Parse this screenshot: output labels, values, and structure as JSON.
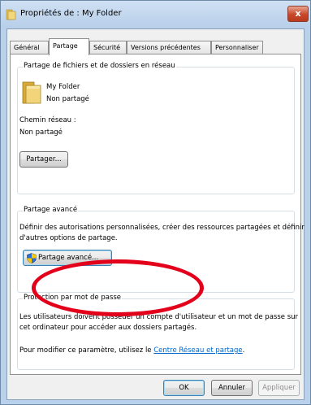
{
  "window": {
    "title": "Propriétés de : My Folder",
    "close_label": "x"
  },
  "tabs": [
    {
      "label": "Général"
    },
    {
      "label": "Partage"
    },
    {
      "label": "Sécurité"
    },
    {
      "label": "Versions précédentes"
    },
    {
      "label": "Personnaliser"
    }
  ],
  "sharing": {
    "group_title": "Partage de fichiers et de dossiers en réseau",
    "folder_name": "My Folder",
    "folder_status": "Non partagé",
    "network_path_label": "Chemin réseau :",
    "network_path_value": "Non partagé",
    "share_button": "Partager..."
  },
  "advanced": {
    "group_title": "Partage avancé",
    "description_line1": "Définir des autorisations personnalisées, créer des ressources partagées et définir",
    "description_line2": "d'autres options de partage.",
    "button": "Partage avancé..."
  },
  "protection": {
    "group_title": "Protection par mot de passe",
    "text_line1": "Les utilisateurs doivent posséder un compte d'utilisateur et un mot de passe sur",
    "text_line2": "cet ordinateur pour accéder aux dossiers partagés.",
    "text_line3": "Pour modifier ce paramètre, utilisez le",
    "link": "Centre Réseau et partage",
    "text_line3_end": "."
  },
  "footer": {
    "ok": "OK",
    "cancel": "Annuler",
    "apply": "Appliquer"
  },
  "colors": {
    "annotation": "#e3001b",
    "link": "#0066cc"
  }
}
